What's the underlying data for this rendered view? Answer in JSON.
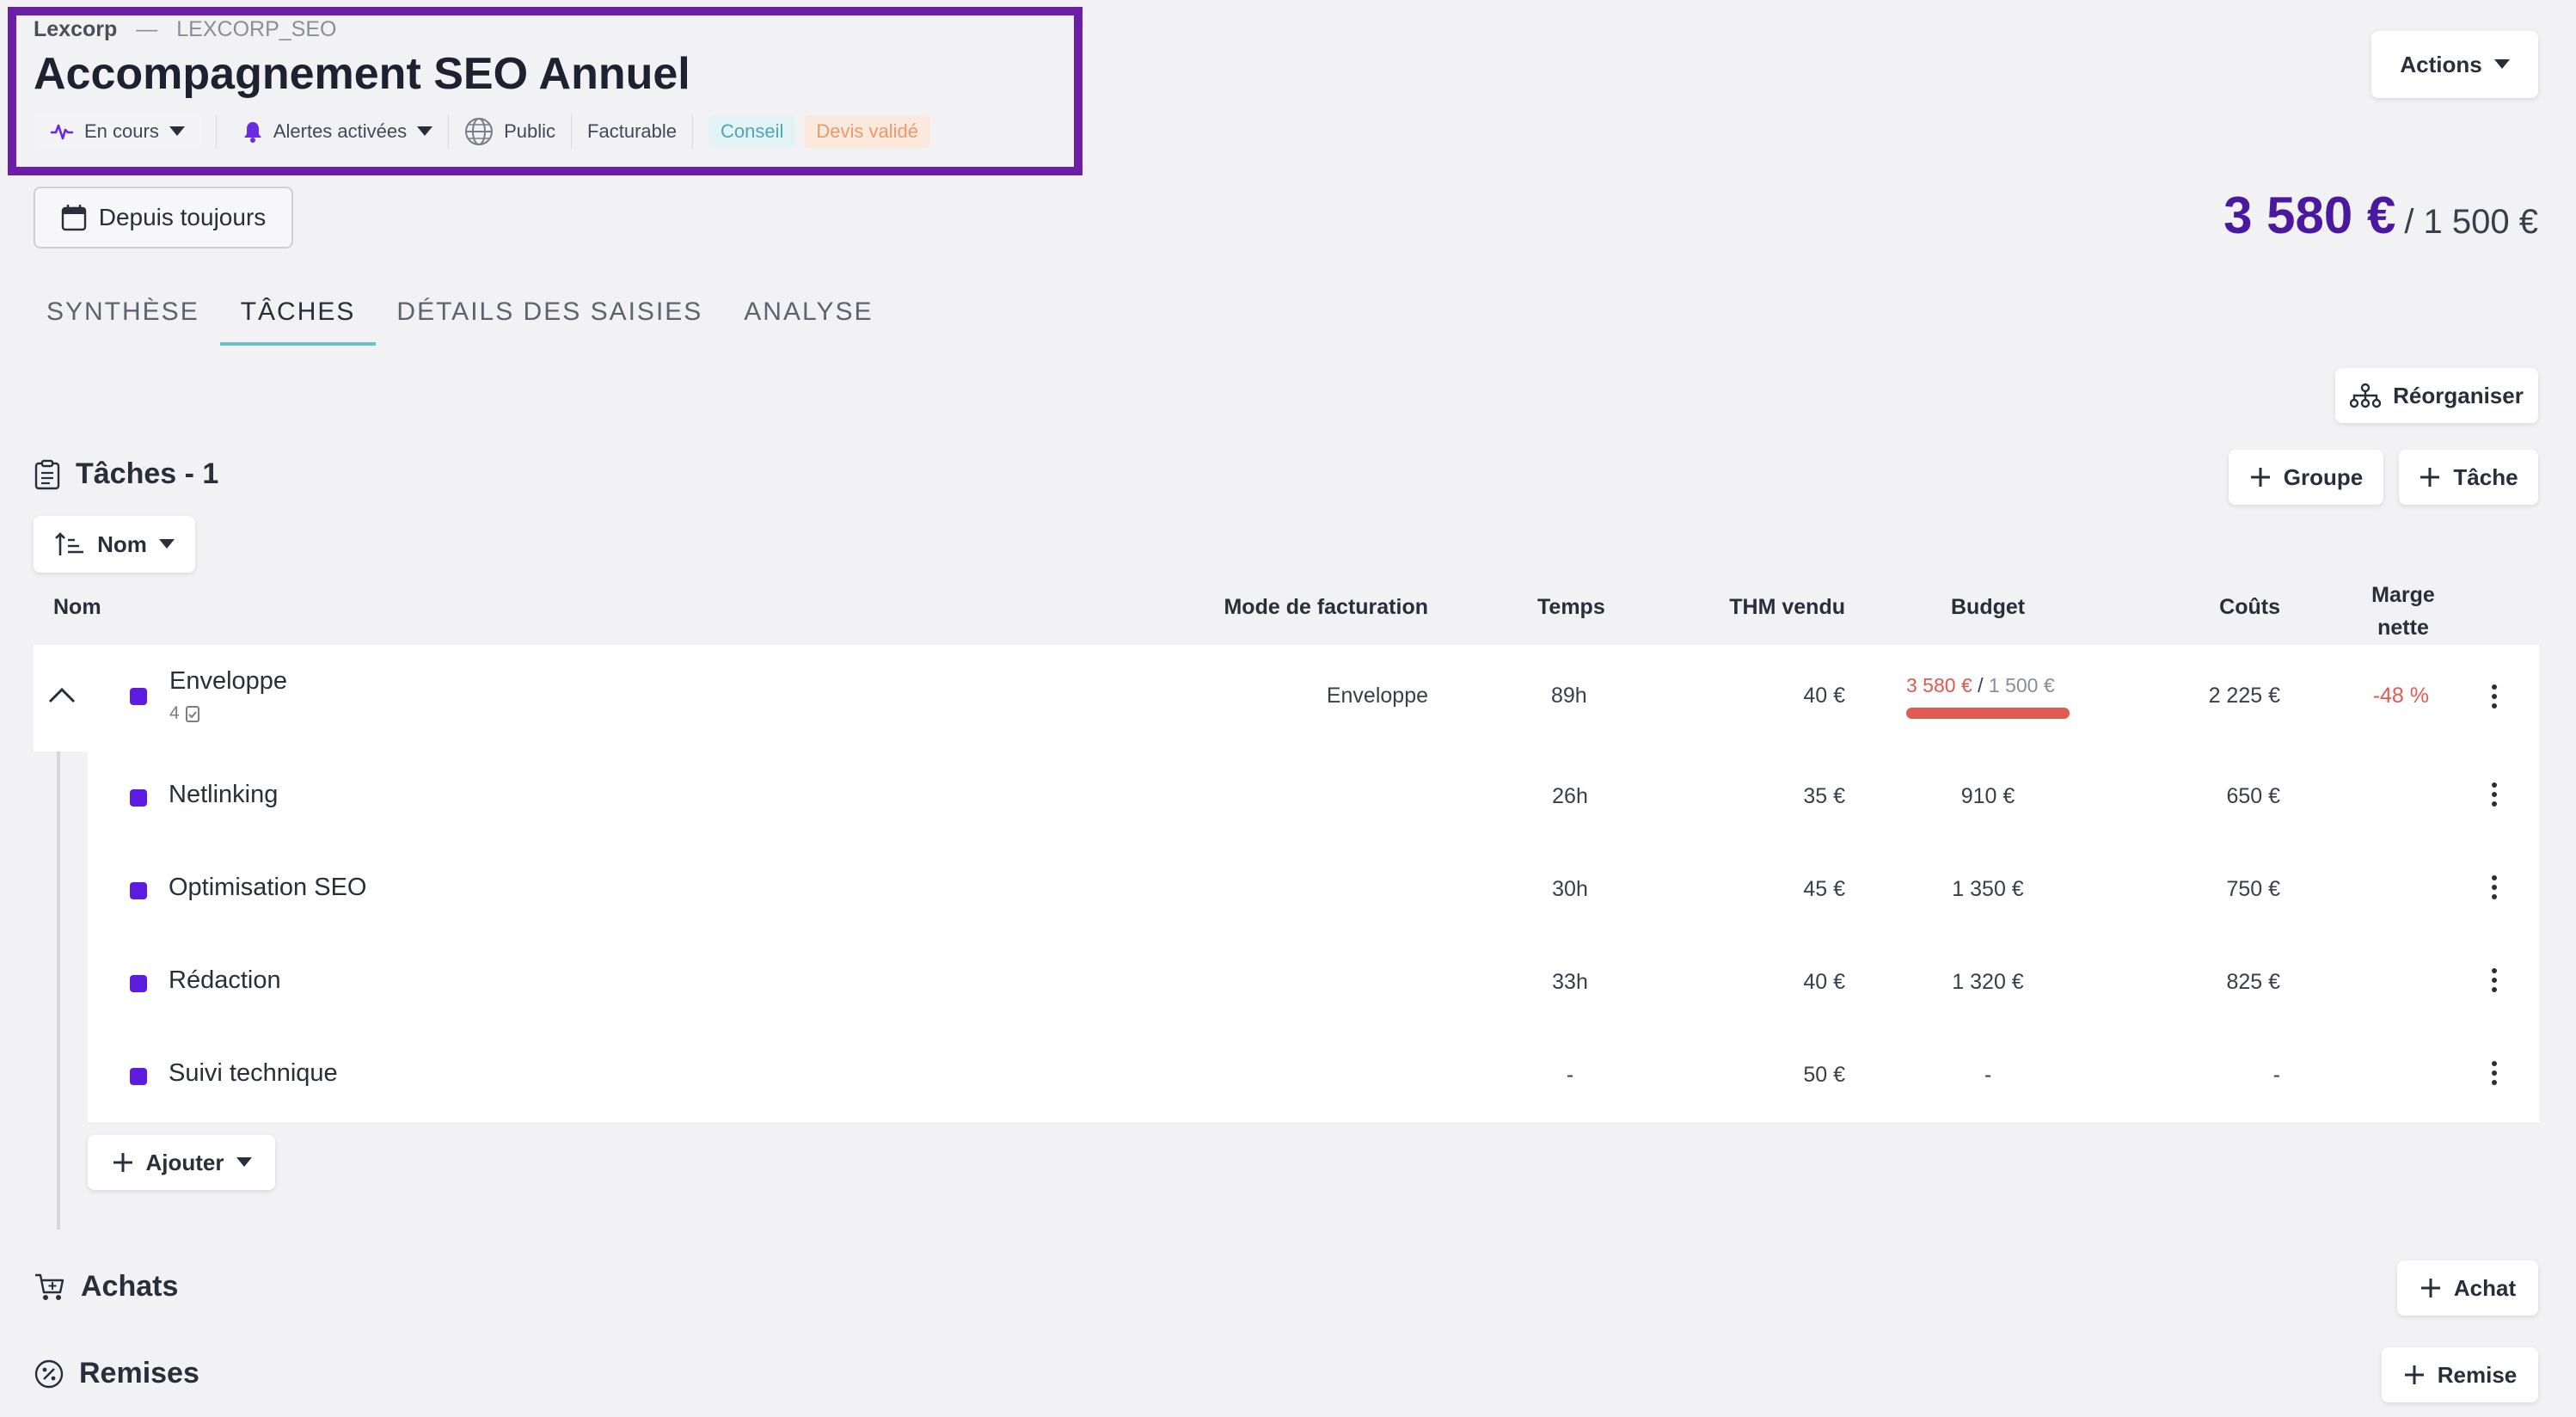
{
  "header": {
    "client": "Lexcorp",
    "separator": "—",
    "code": "LEXCORP_SEO",
    "title": "Accompagnement SEO Annuel",
    "status": "En cours",
    "alerts": "Alertes activées",
    "visibility": "Public",
    "billing": "Facturable",
    "tags": [
      {
        "label": "Conseil",
        "color": "#4ea6b8",
        "bg": "#e3f2f5"
      },
      {
        "label": "Devis validé",
        "color": "#e89a6c",
        "bg": "#fbe9de"
      }
    ],
    "actions_label": "Actions"
  },
  "period_label": "Depuis toujours",
  "total": {
    "spent": "3 580 €",
    "budget": "/ 1 500 €"
  },
  "tabs": [
    "SYNTHÈSE",
    "TÂCHES",
    "DÉTAILS DES SAISIES",
    "ANALYSE"
  ],
  "active_tab": "TÂCHES",
  "reorganize_label": "Réorganiser",
  "tasks": {
    "title": "Tâches - 1",
    "add_group": "Groupe",
    "add_task": "Tâche",
    "sort_label": "Nom",
    "columns": {
      "name": "Nom",
      "mode": "Mode de facturation",
      "time": "Temps",
      "thm": "THM vendu",
      "budget": "Budget",
      "costs": "Coûts",
      "margin_1": "Marge",
      "margin_2": "nette"
    },
    "group": {
      "name": "Enveloppe",
      "count": "4",
      "mode": "Enveloppe",
      "time": "89h",
      "thm": "40 €",
      "budget_spent": "3 580 €",
      "budget_sep": " / ",
      "budget_total": "1 500 €",
      "budget_progress": 1.0,
      "costs": "2 225 €",
      "margin": "-48 %"
    },
    "rows": [
      {
        "name": "Netlinking",
        "time": "26h",
        "thm": "35 €",
        "budget": "910 €",
        "costs": "650 €"
      },
      {
        "name": "Optimisation SEO",
        "time": "30h",
        "thm": "45 €",
        "budget": "1 350 €",
        "costs": "750 €"
      },
      {
        "name": "Rédaction",
        "time": "33h",
        "thm": "40 €",
        "budget": "1 320 €",
        "costs": "825 €"
      },
      {
        "name": "Suivi technique",
        "time": "-",
        "thm": "50 €",
        "budget": "-",
        "costs": "-"
      }
    ],
    "add_label": "Ajouter"
  },
  "purchases": {
    "title": "Achats",
    "add_label": "Achat"
  },
  "discounts": {
    "title": "Remises",
    "add_label": "Remise"
  },
  "colors": {
    "accent": "#4b19a0",
    "task_dot": "#5b1ce0",
    "negative": "#e05a4f",
    "highlight_border": "#6a1fa6"
  }
}
